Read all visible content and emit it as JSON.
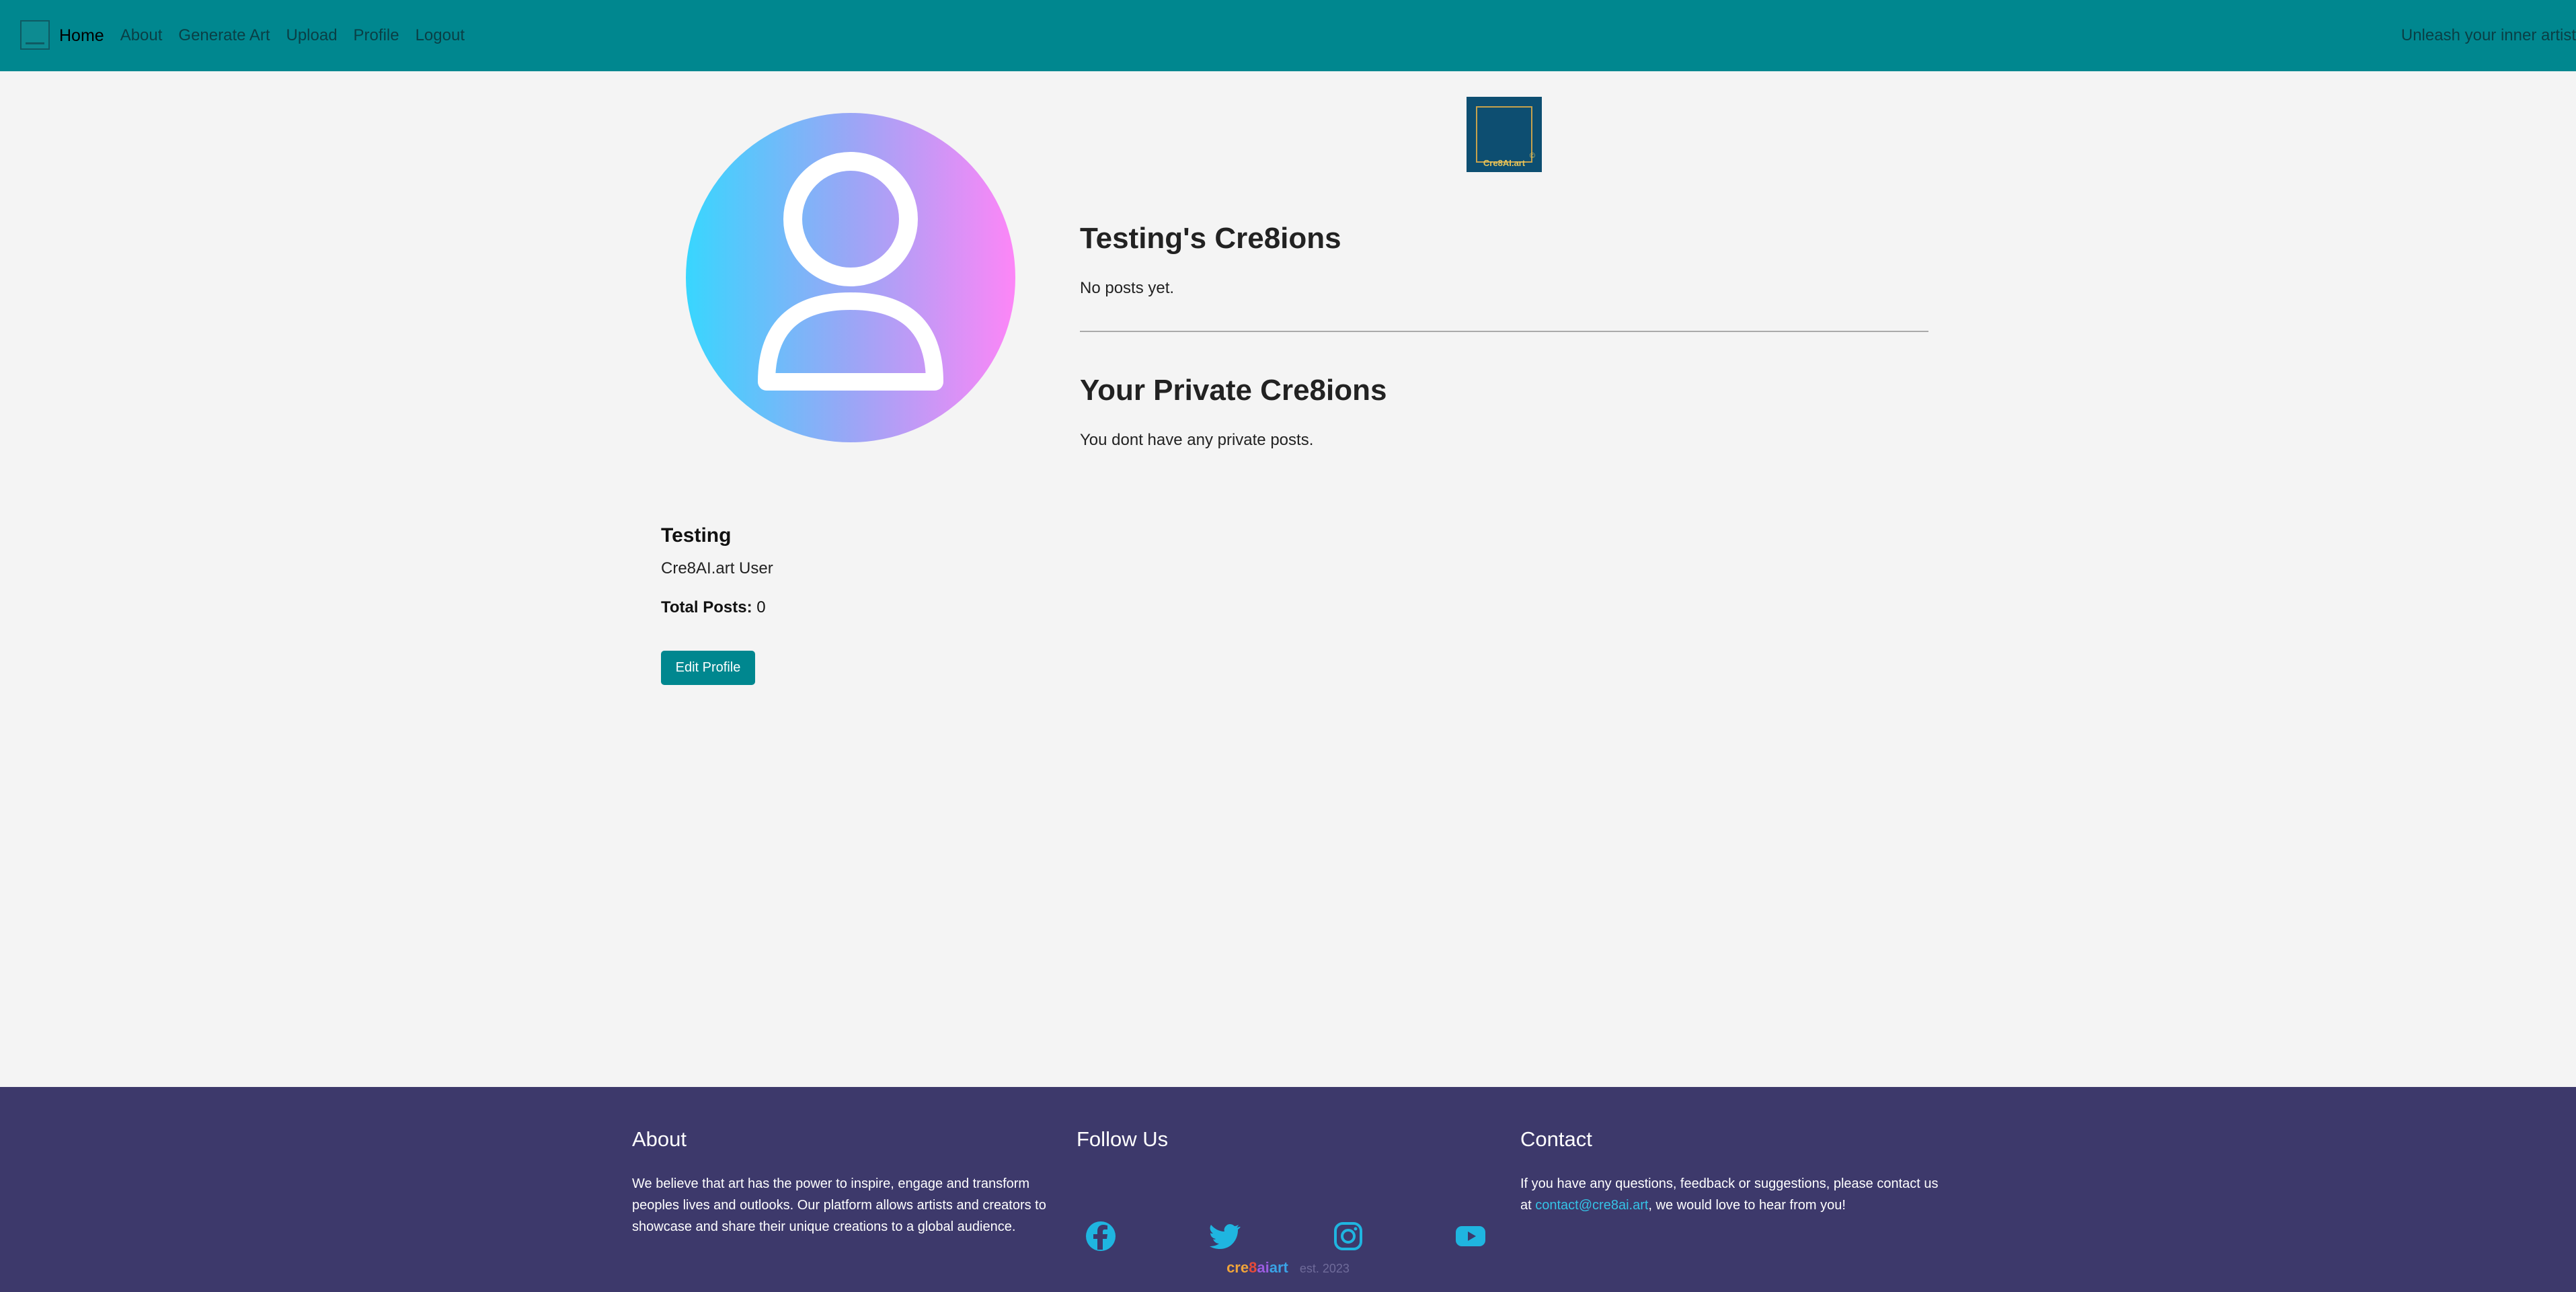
{
  "nav": {
    "items": [
      {
        "label": "Home"
      },
      {
        "label": "About"
      },
      {
        "label": "Generate Art"
      },
      {
        "label": "Upload"
      },
      {
        "label": "Profile"
      },
      {
        "label": "Logout"
      }
    ],
    "tagline": "Unleash your inner artist"
  },
  "brand": {
    "badge_text": "Cre8AI.art",
    "badge_mark": "©"
  },
  "profile": {
    "name": "Testing",
    "role": "Cre8AI.art User",
    "total_posts_label": "Total Posts:",
    "total_posts_value": "0",
    "edit_button": "Edit Profile"
  },
  "public": {
    "title": "Testing's Cre8ions",
    "empty": "No posts yet."
  },
  "private": {
    "title": "Your Private Cre8ions",
    "empty": "You dont have any private posts."
  },
  "footer": {
    "about": {
      "title": "About",
      "text": "We believe that art has the power to inspire, engage and transform peoples lives and outlooks. Our platform allows artists and creators to showcase and share their unique creations to a global audience."
    },
    "follow": {
      "title": "Follow Us",
      "icons": [
        "facebook-icon",
        "twitter-icon",
        "instagram-icon",
        "youtube-icon"
      ]
    },
    "contact": {
      "title": "Contact",
      "text_before": "If you have any questions, feedback or suggestions, please contact us at ",
      "email": "contact@cre8ai.art",
      "text_after": ", we would love to hear from you!"
    },
    "bottom": {
      "logo_parts": [
        "cre",
        "8",
        "ai",
        "art"
      ],
      "established": "est. 2023"
    }
  },
  "colors": {
    "nav_bg": "#00878f",
    "page_bg": "#f4f4f4",
    "footer_bg": "#3d396b",
    "accent": "#00878f",
    "link": "#35c3e6",
    "social_icon": "#1fb5e0"
  }
}
